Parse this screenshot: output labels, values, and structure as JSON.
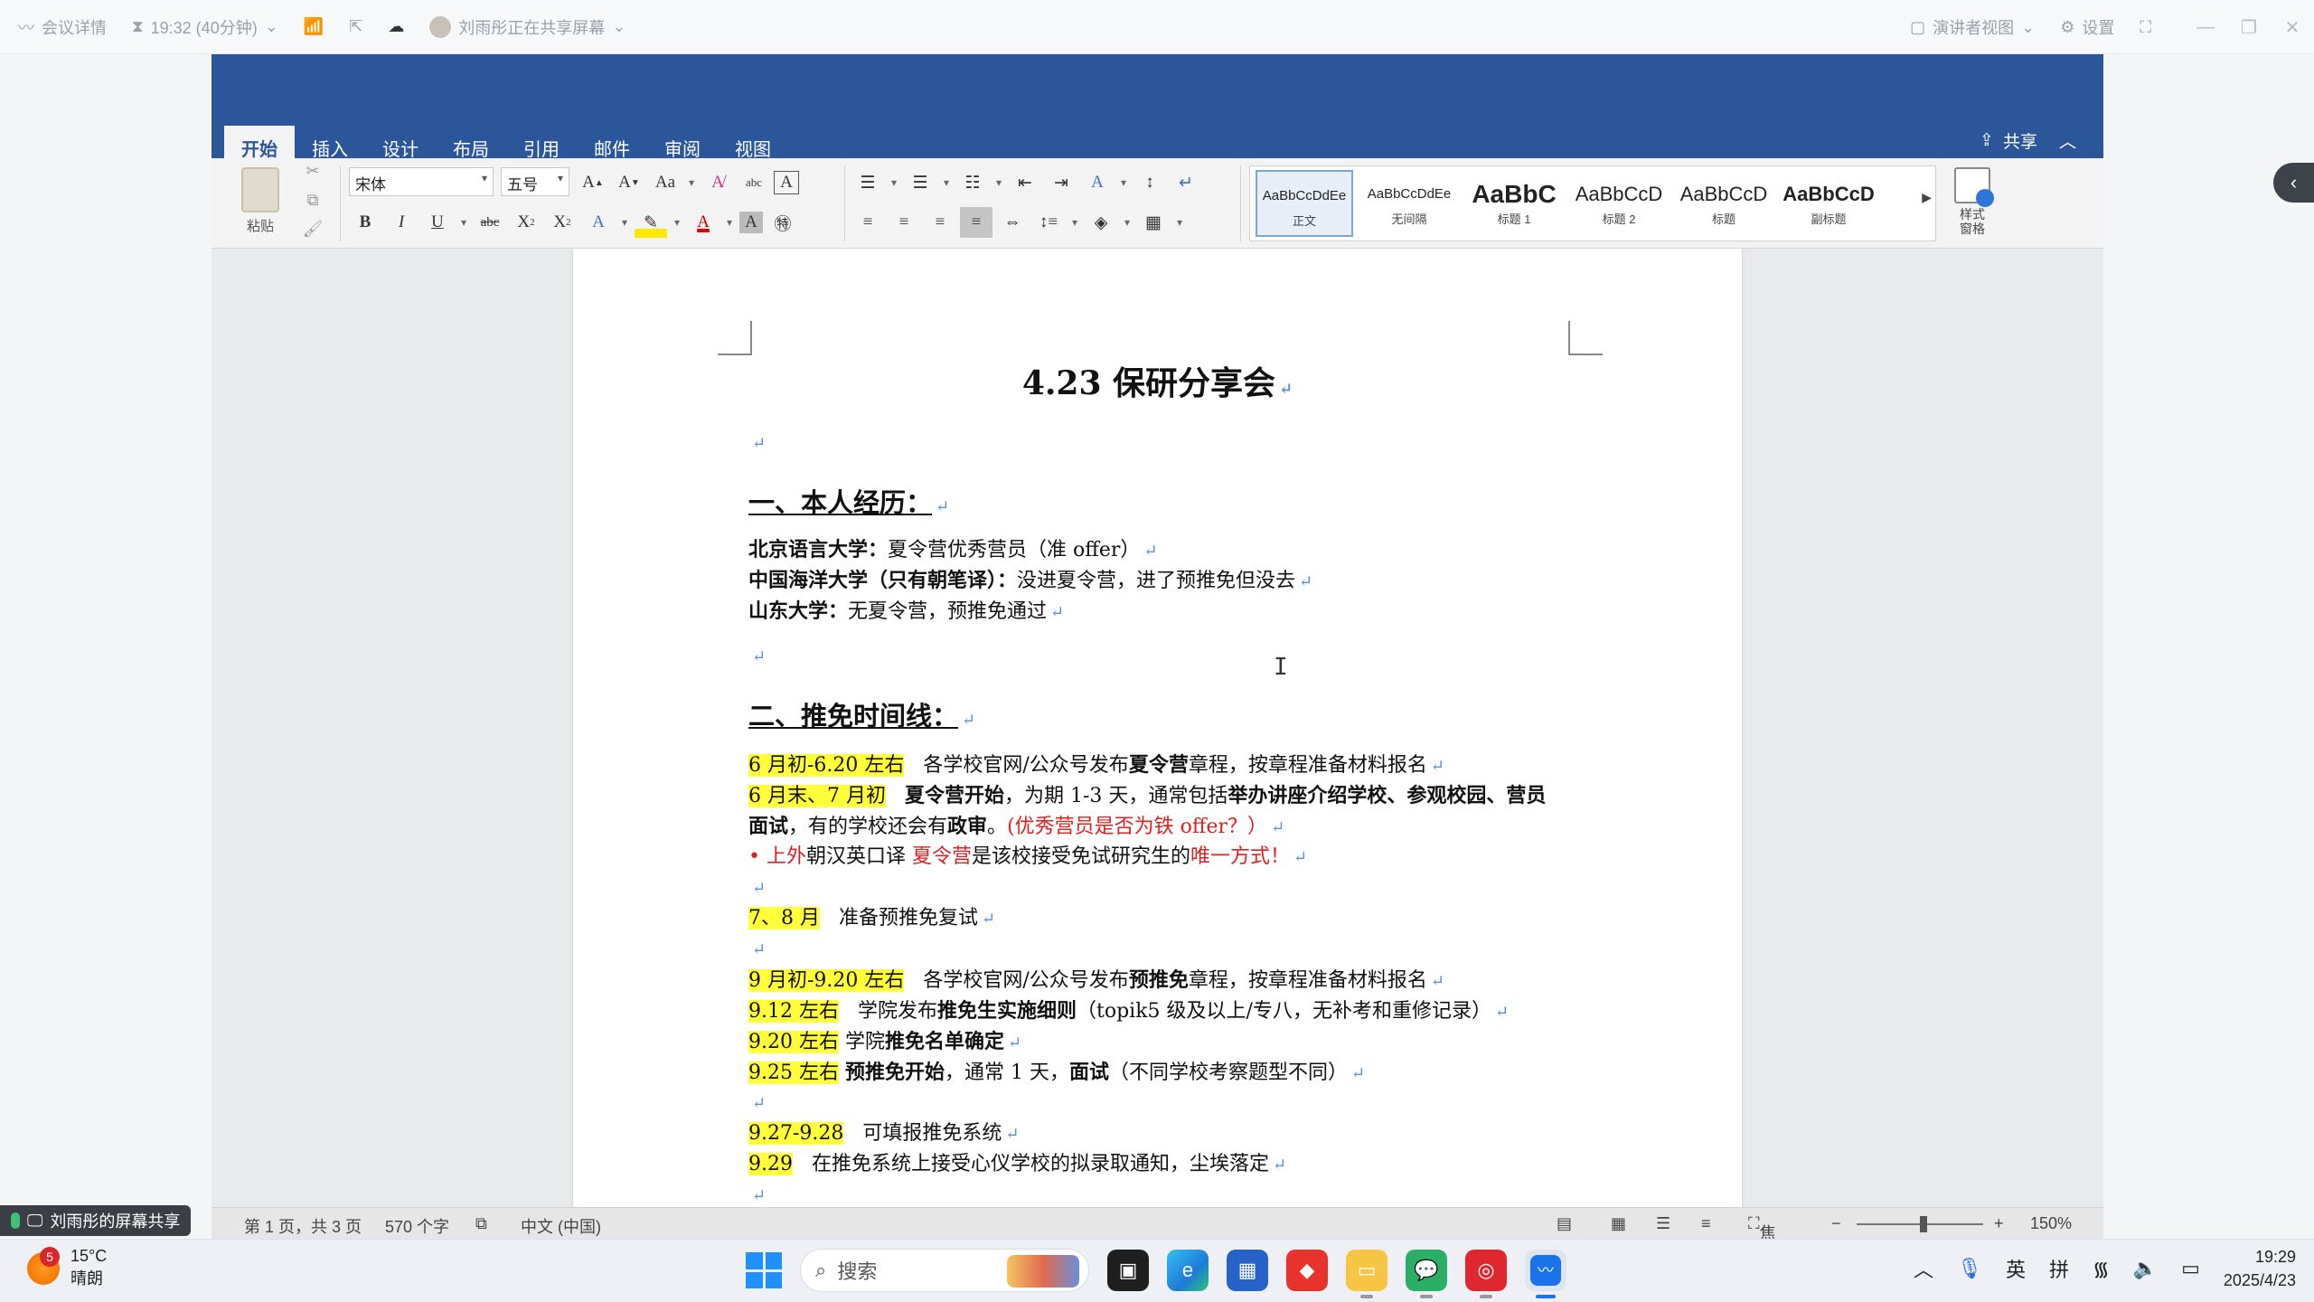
{
  "meeting_bar": {
    "details": "会议详情",
    "timer": "19:32 (40分钟)",
    "sharing": "刘雨彤正在共享屏幕",
    "presenter_view": "演讲者视图",
    "settings": "设置"
  },
  "ribbon": {
    "tabs": [
      "开始",
      "插入",
      "设计",
      "布局",
      "引用",
      "邮件",
      "审阅",
      "视图"
    ],
    "share": "共享",
    "paste": "粘贴",
    "font_name": "宋体",
    "font_size": "五号",
    "styles": [
      {
        "preview": "AaBbCcDdEe",
        "name": "正文"
      },
      {
        "preview": "AaBbCcDdEe",
        "name": "无间隔"
      },
      {
        "preview": "AaBbC",
        "name": "标题 1"
      },
      {
        "preview": "AaBbCcD",
        "name": "标题 2"
      },
      {
        "preview": "AaBbCcD",
        "name": "标题"
      },
      {
        "preview": "AaBbCcD",
        "name": "副标题"
      }
    ],
    "style_pane": "样式\n窗格"
  },
  "document": {
    "title": "4.23 保研分享会",
    "h1": "一、本人经历：",
    "exp1_label": "北京语言大学：",
    "exp1_text": "夏令营优秀营员（准 offer）",
    "exp2_label": "中国海洋大学（只有朝笔译）：",
    "exp2_text": "没进夏令营，进了预推免但没去",
    "exp3_label": "山东大学：",
    "exp3_text": "无夏令营，预推免通过",
    "h2": "二、推免时间线：",
    "t1_date": "6 月初-6.20 左右",
    "t1_a": "各学校官网/公众号发布",
    "t1_b": "夏令营",
    "t1_c": "章程，按章程准备材料报名",
    "t2_date": "6 月末、7 月初",
    "t2_a": "夏令营开始",
    "t2_b": "，为期 1-3 天，通常包括",
    "t2_c": "举办讲座介绍学校、参观校园、营员",
    "t2_d": "面试",
    "t2_e": "，有的学校还会有",
    "t2_f": "政审",
    "t2_g": "。",
    "t2_h": "(优秀营员是否为铁 offer？）",
    "t3_bullet": "•",
    "t3_a": "上外",
    "t3_b": "朝汉英口译 ",
    "t3_c": "夏令营",
    "t3_d": "是该校接受免试研究生的",
    "t3_e": "唯一方式！",
    "t4_date": "7、8 月",
    "t4_a": "准备预推免复试",
    "t5_date": "9 月初-9.20 左右",
    "t5_a": "各学校官网/公众号发布",
    "t5_b": "预推免",
    "t5_c": "章程，按章程准备材料报名",
    "t6_date": "9.12 左右",
    "t6_a": "学院发布",
    "t6_b": "推免生实施细则",
    "t6_c": "（topik5 级及以上/专八，无补考和重修记录）",
    "t7_date": "9.20 左右",
    "t7_a": "学院",
    "t7_b": "推免名单确定",
    "t8_date": "9.25 左右",
    "t8_a": "预推免开始",
    "t8_b": "，通常 1 天，",
    "t8_c": "面试",
    "t8_d": "（不同学校考察题型不同）",
    "t9_date": "9.27-9.28",
    "t9_a": "可填报推免系统",
    "t10_date": "9.29",
    "t10_a": "在推免系统上接受心仪学校的拟录取通知，尘埃落定"
  },
  "status_bar": {
    "page": "第 1 页，共 3 页",
    "words": "570 个字",
    "language": "中文 (中国)",
    "focus": "焦点",
    "zoom": "150%"
  },
  "share_badge": "刘雨彤的屏幕共享",
  "taskbar": {
    "badge_count": "5",
    "temperature": "15°C",
    "weather": "晴朗",
    "search_placeholder": "搜索",
    "ime_lang": "英",
    "ime_mode": "拼",
    "time": "19:29",
    "date": "2025/4/23"
  }
}
